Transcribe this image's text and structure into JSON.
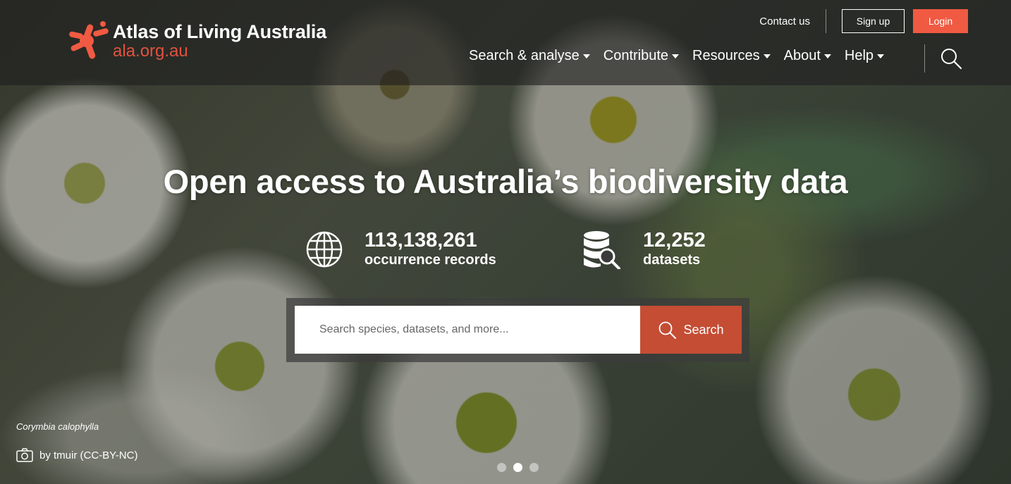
{
  "brand": {
    "name": "Atlas of Living Australia",
    "url": "ala.org.au",
    "accent_color": "#f05a42"
  },
  "top_links": {
    "contact": "Contact us",
    "signup": "Sign up",
    "login": "Login"
  },
  "nav": {
    "items": [
      {
        "label": "Search & analyse"
      },
      {
        "label": "Contribute"
      },
      {
        "label": "Resources"
      },
      {
        "label": "About"
      },
      {
        "label": "Help"
      }
    ],
    "search_icon": "search-icon"
  },
  "hero": {
    "title": "Open access to Australia’s biodiversity data",
    "stats": [
      {
        "icon": "globe-icon",
        "value": "113,138,261",
        "label": "occurrence records"
      },
      {
        "icon": "database-search-icon",
        "value": "12,252",
        "label": "datasets"
      }
    ],
    "search": {
      "placeholder": "Search species, datasets, and more...",
      "button_label": "Search",
      "button_color": "#c44d34"
    }
  },
  "photo_caption": {
    "species": "Corymbia calophylla",
    "credit": "by tmuir (CC-BY-NC)"
  },
  "carousel": {
    "slide_count": 3,
    "active_index": 1
  }
}
